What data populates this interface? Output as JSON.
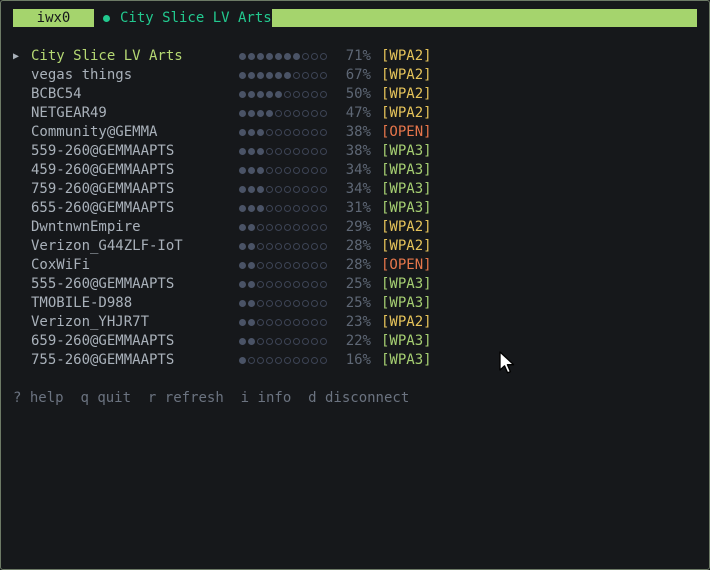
{
  "topbar": {
    "interface": "iwx0",
    "connected_ssid": "City Slice LV Arts"
  },
  "networks": [
    {
      "ssid": "City Slice LV Arts",
      "signal": 71,
      "bars": 7,
      "security": "[WPA2]",
      "type": "wpa2",
      "selected": true
    },
    {
      "ssid": "vegas things",
      "signal": 67,
      "bars": 6,
      "security": "[WPA2]",
      "type": "wpa2"
    },
    {
      "ssid": "BCBC54",
      "signal": 50,
      "bars": 5,
      "security": "[WPA2]",
      "type": "wpa2"
    },
    {
      "ssid": "NETGEAR49",
      "signal": 47,
      "bars": 4,
      "security": "[WPA2]",
      "type": "wpa2"
    },
    {
      "ssid": "Community@GEMMA",
      "signal": 38,
      "bars": 3,
      "security": "[OPEN]",
      "type": "open"
    },
    {
      "ssid": "559-260@GEMMAAPTS",
      "signal": 38,
      "bars": 3,
      "security": "[WPA3]",
      "type": "wpa3"
    },
    {
      "ssid": "459-260@GEMMAAPTS",
      "signal": 34,
      "bars": 3,
      "security": "[WPA3]",
      "type": "wpa3"
    },
    {
      "ssid": "759-260@GEMMAAPTS",
      "signal": 34,
      "bars": 3,
      "security": "[WPA3]",
      "type": "wpa3"
    },
    {
      "ssid": "655-260@GEMMAAPTS",
      "signal": 31,
      "bars": 3,
      "security": "[WPA3]",
      "type": "wpa3"
    },
    {
      "ssid": "DwntnwnEmpire",
      "signal": 29,
      "bars": 2,
      "security": "[WPA2]",
      "type": "wpa2"
    },
    {
      "ssid": "Verizon_G44ZLF-IoT",
      "signal": 28,
      "bars": 2,
      "security": "[WPA2]",
      "type": "wpa2"
    },
    {
      "ssid": "CoxWiFi",
      "signal": 28,
      "bars": 2,
      "security": "[OPEN]",
      "type": "open"
    },
    {
      "ssid": "555-260@GEMMAAPTS",
      "signal": 25,
      "bars": 2,
      "security": "[WPA3]",
      "type": "wpa3"
    },
    {
      "ssid": "TMOBILE-D988",
      "signal": 25,
      "bars": 2,
      "security": "[WPA3]",
      "type": "wpa3"
    },
    {
      "ssid": "Verizon_YHJR7T",
      "signal": 23,
      "bars": 2,
      "security": "[WPA2]",
      "type": "wpa2"
    },
    {
      "ssid": "659-260@GEMMAAPTS",
      "signal": 22,
      "bars": 2,
      "security": "[WPA3]",
      "type": "wpa3"
    },
    {
      "ssid": "755-260@GEMMAAPTS",
      "signal": 16,
      "bars": 1,
      "security": "[WPA3]",
      "type": "wpa3"
    }
  ],
  "total_bars": 10,
  "selected_marker": "▶",
  "help": [
    {
      "key": "?",
      "label": "help"
    },
    {
      "key": "q",
      "label": "quit"
    },
    {
      "key": "r",
      "label": "refresh"
    },
    {
      "key": "i",
      "label": "info"
    },
    {
      "key": "d",
      "label": "disconnect"
    }
  ],
  "colors": {
    "accent_bar": "#a5d46d",
    "connected": "#22c98f",
    "wpa2": "#e6c45a",
    "wpa3": "#a6cf72",
    "open": "#e7764b"
  }
}
